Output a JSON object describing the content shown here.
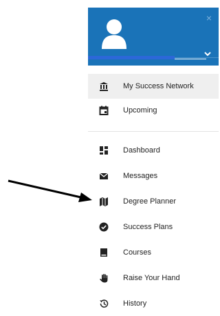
{
  "header": {
    "close_label": "×",
    "colors": {
      "header_bg": "#1a73b8",
      "select_fill": "#2c68d8"
    }
  },
  "nav": {
    "top_items": [
      {
        "label": "My Success Network",
        "icon": "bank-icon",
        "active": true
      },
      {
        "label": "Upcoming",
        "icon": "calendar-icon",
        "active": false
      }
    ],
    "items": [
      {
        "label": "Dashboard",
        "icon": "dashboard-icon"
      },
      {
        "label": "Messages",
        "icon": "envelope-icon"
      },
      {
        "label": "Degree Planner",
        "icon": "map-icon"
      },
      {
        "label": "Success Plans",
        "icon": "check-circle-icon"
      },
      {
        "label": "Courses",
        "icon": "book-icon"
      },
      {
        "label": "Raise Your Hand",
        "icon": "hand-icon"
      },
      {
        "label": "History",
        "icon": "history-icon"
      }
    ]
  },
  "annotation": {
    "arrow_icon": "arrow-right-icon",
    "target": "Degree Planner"
  }
}
